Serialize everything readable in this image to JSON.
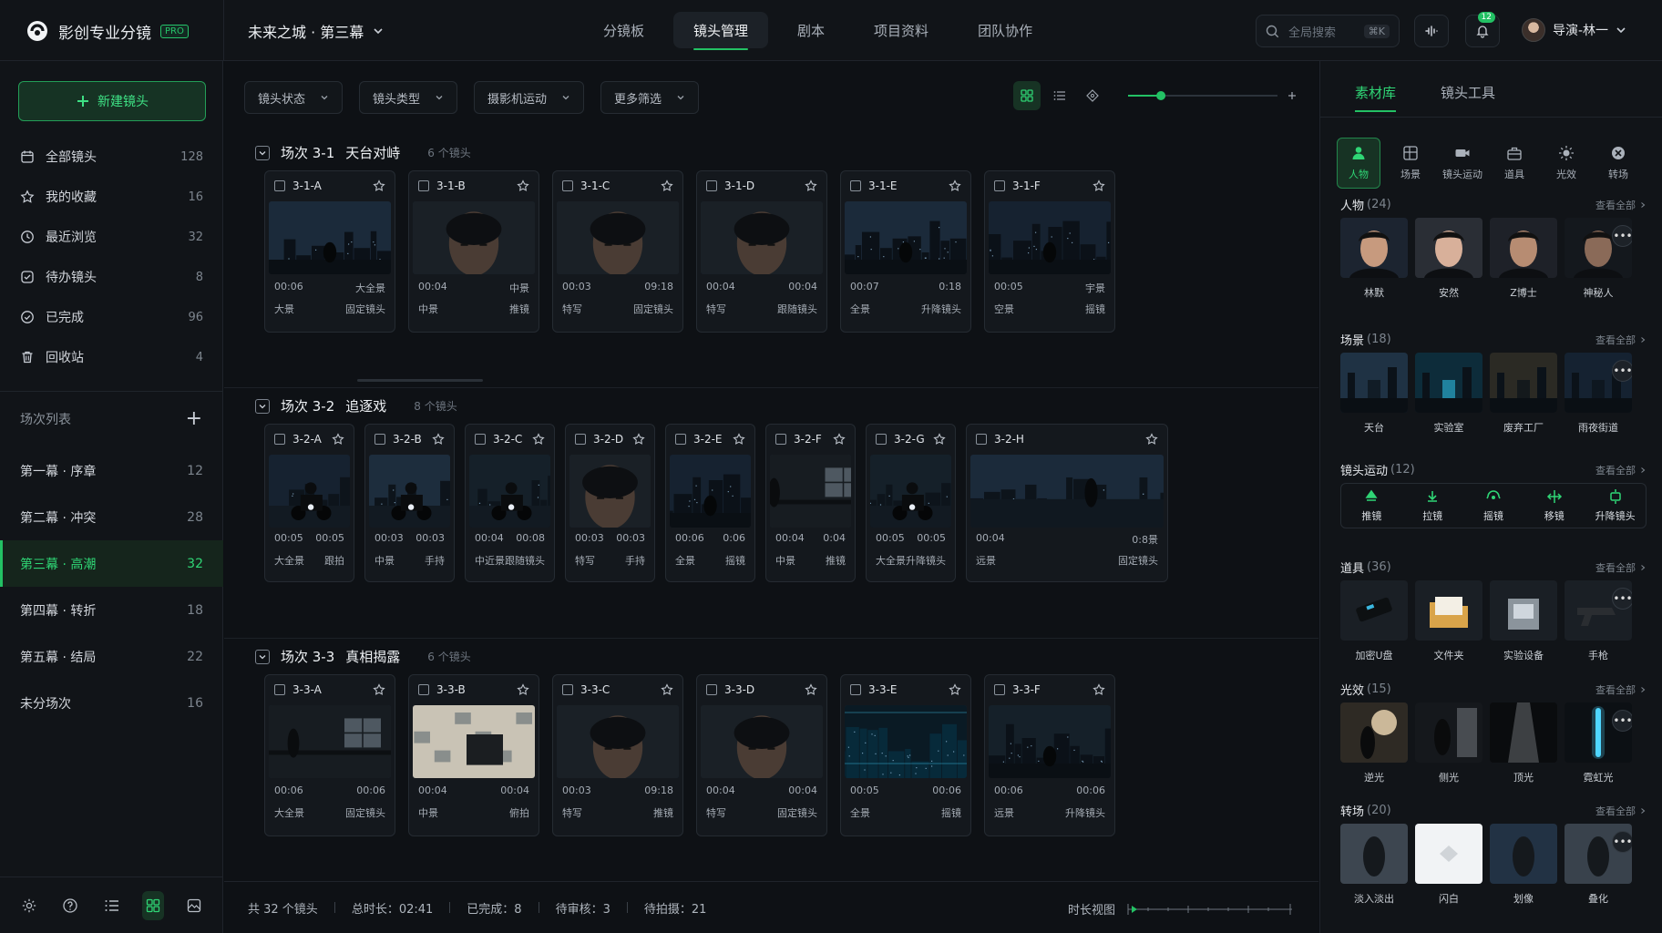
{
  "app": {
    "name": "影创专业分镜",
    "badge": "PRO"
  },
  "project": {
    "title": "未来之城 · 第三幕"
  },
  "nav": [
    "分镜板",
    "镜头管理",
    "剧本",
    "项目资料",
    "团队协作"
  ],
  "search": {
    "placeholder": "全局搜索",
    "shortcut": "⌘K"
  },
  "notifications": {
    "count": "12"
  },
  "user": {
    "name": "导演-林一"
  },
  "sidebar": {
    "new_button": "新建镜头",
    "menu": [
      {
        "label": "全部镜头",
        "count": "128",
        "icon": "calendar-icon"
      },
      {
        "label": "我的收藏",
        "count": "16",
        "icon": "star-icon"
      },
      {
        "label": "最近浏览",
        "count": "32",
        "icon": "clock-icon"
      },
      {
        "label": "待办镜头",
        "count": "8",
        "icon": "todo-icon"
      },
      {
        "label": "已完成",
        "count": "96",
        "icon": "check-circle-icon"
      },
      {
        "label": "回收站",
        "count": "4",
        "icon": "trash-icon"
      }
    ],
    "scenes_title": "场次列表",
    "acts": [
      {
        "label": "第一幕 · 序章",
        "count": "12"
      },
      {
        "label": "第二幕 · 冲突",
        "count": "28"
      },
      {
        "label": "第三幕 · 高潮",
        "count": "32"
      },
      {
        "label": "第四幕 · 转折",
        "count": "18"
      },
      {
        "label": "第五幕 · 结局",
        "count": "22"
      },
      {
        "label": "未分场次",
        "count": "16"
      }
    ]
  },
  "filters": [
    "镜头状态",
    "镜头类型",
    "摄影机运动",
    "更多筛选"
  ],
  "zoom": {
    "level": 0.22
  },
  "status_colors": {
    "已完成": "#23c164",
    "已审核": "#2f7cf6",
    "待审核": "#f2b023",
    "待拍摄": "#7a5cf5"
  },
  "scenes": [
    {
      "title": "场次 3-1",
      "name": "天台对峙",
      "count": "6 个镜头",
      "shots": [
        {
          "id": "3-1-A",
          "duration": "00:06",
          "type": "大全景",
          "size": "大景",
          "move": "固定镜头",
          "status": "已完成"
        },
        {
          "id": "3-1-B",
          "duration": "00:04",
          "type": "中景",
          "size": "中景",
          "move": "推镜",
          "status": "已完成"
        },
        {
          "id": "3-1-C",
          "duration": "00:03",
          "type": "09:18",
          "size": "特写",
          "move": "固定镜头",
          "status": "已审核"
        },
        {
          "id": "3-1-D",
          "duration": "00:04",
          "type": "00:04",
          "size": "特写",
          "move": "跟随镜头",
          "status": "待审核"
        },
        {
          "id": "3-1-E",
          "duration": "00:07",
          "type": "0:18",
          "size": "全景",
          "move": "升降镜头",
          "status": "待拍摄"
        },
        {
          "id": "3-1-F",
          "duration": "00:05",
          "type": "宇景",
          "size": "空景",
          "move": "摇镜",
          "status": "待拍摄"
        }
      ]
    },
    {
      "title": "场次 3-2",
      "name": "追逐戏",
      "count": "8 个镜头",
      "shots": [
        {
          "id": "3-2-A",
          "duration": "00:05",
          "type": "00:05",
          "size": "大全景",
          "move": "跟拍",
          "status": "已完成"
        },
        {
          "id": "3-2-B",
          "duration": "00:03",
          "type": "00:03",
          "size": "中景",
          "move": "手持",
          "status": "已完成"
        },
        {
          "id": "3-2-C",
          "duration": "00:04",
          "type": "00:08",
          "size": "中近景",
          "move": "跟随镜头",
          "status": "已审核"
        },
        {
          "id": "3-2-D",
          "duration": "00:03",
          "type": "00:03",
          "size": "特写",
          "move": "手持",
          "status": "待审核"
        },
        {
          "id": "3-2-E",
          "duration": "00:06",
          "type": "0:06",
          "size": "全景",
          "move": "摇镜",
          "status": "待拍摄"
        },
        {
          "id": "3-2-F",
          "duration": "00:04",
          "type": "0:04",
          "size": "中景",
          "move": "推镜",
          "status": "待拍摄"
        },
        {
          "id": "3-2-G",
          "duration": "00:05",
          "type": "00:05",
          "size": "大全景",
          "move": "升降镜头",
          "status": "待拍摄"
        },
        {
          "id": "3-2-H",
          "duration": "00:04",
          "type": "0:8景",
          "size": "远景",
          "move": "固定镜头",
          "status": "待拍摄"
        }
      ]
    },
    {
      "title": "场次 3-3",
      "name": "真相揭露",
      "count": "6 个镜头",
      "shots": [
        {
          "id": "3-3-A",
          "duration": "00:06",
          "type": "00:06",
          "size": "大全景",
          "move": "固定镜头",
          "status": "已完成"
        },
        {
          "id": "3-3-B",
          "duration": "00:04",
          "type": "00:04",
          "size": "中景",
          "move": "俯拍",
          "status": "已审核"
        },
        {
          "id": "3-3-C",
          "duration": "00:03",
          "type": "09:18",
          "size": "特写",
          "move": "推镜",
          "status": "待审核"
        },
        {
          "id": "3-3-D",
          "duration": "00:04",
          "type": "00:04",
          "size": "特写",
          "move": "固定镜头",
          "status": "待拍摄"
        },
        {
          "id": "3-3-E",
          "duration": "00:05",
          "type": "00:06",
          "size": "全景",
          "move": "摇镜",
          "status": "待拍摄"
        },
        {
          "id": "3-3-F",
          "duration": "00:06",
          "type": "00:06",
          "size": "远景",
          "move": "升降镜头",
          "status": "待拍摄"
        }
      ]
    }
  ],
  "footer": {
    "total": "共 32 个镜头",
    "duration": "总时长：02:41",
    "done": "已完成：8",
    "review": "待审核：3",
    "pending": "待拍摄：21",
    "timeline": "时长视图"
  },
  "right": {
    "tabs": [
      "素材库",
      "镜头工具"
    ],
    "categories": [
      "人物",
      "场景",
      "镜头运动",
      "道具",
      "光效",
      "转场"
    ],
    "view_all": "查看全部",
    "sections": [
      {
        "title": "人物",
        "count": "(24)",
        "items": [
          "林默",
          "安然",
          "Z博士",
          "神秘人"
        ]
      },
      {
        "title": "场景",
        "count": "(18)",
        "items": [
          "天台",
          "实验室",
          "废弃工厂",
          "雨夜街道"
        ]
      },
      {
        "title": "镜头运动",
        "count": "(12)",
        "items": [
          "推镜",
          "拉镜",
          "摇镜",
          "移镜",
          "升降镜头"
        ]
      },
      {
        "title": "道具",
        "count": "(36)",
        "items": [
          "加密U盘",
          "文件夹",
          "实验设备",
          "手枪"
        ]
      },
      {
        "title": "光效",
        "count": "(15)",
        "items": [
          "逆光",
          "侧光",
          "顶光",
          "霓虹光"
        ]
      },
      {
        "title": "转场",
        "count": "(20)",
        "items": [
          "淡入淡出",
          "闪白",
          "划像",
          "叠化"
        ]
      }
    ]
  }
}
